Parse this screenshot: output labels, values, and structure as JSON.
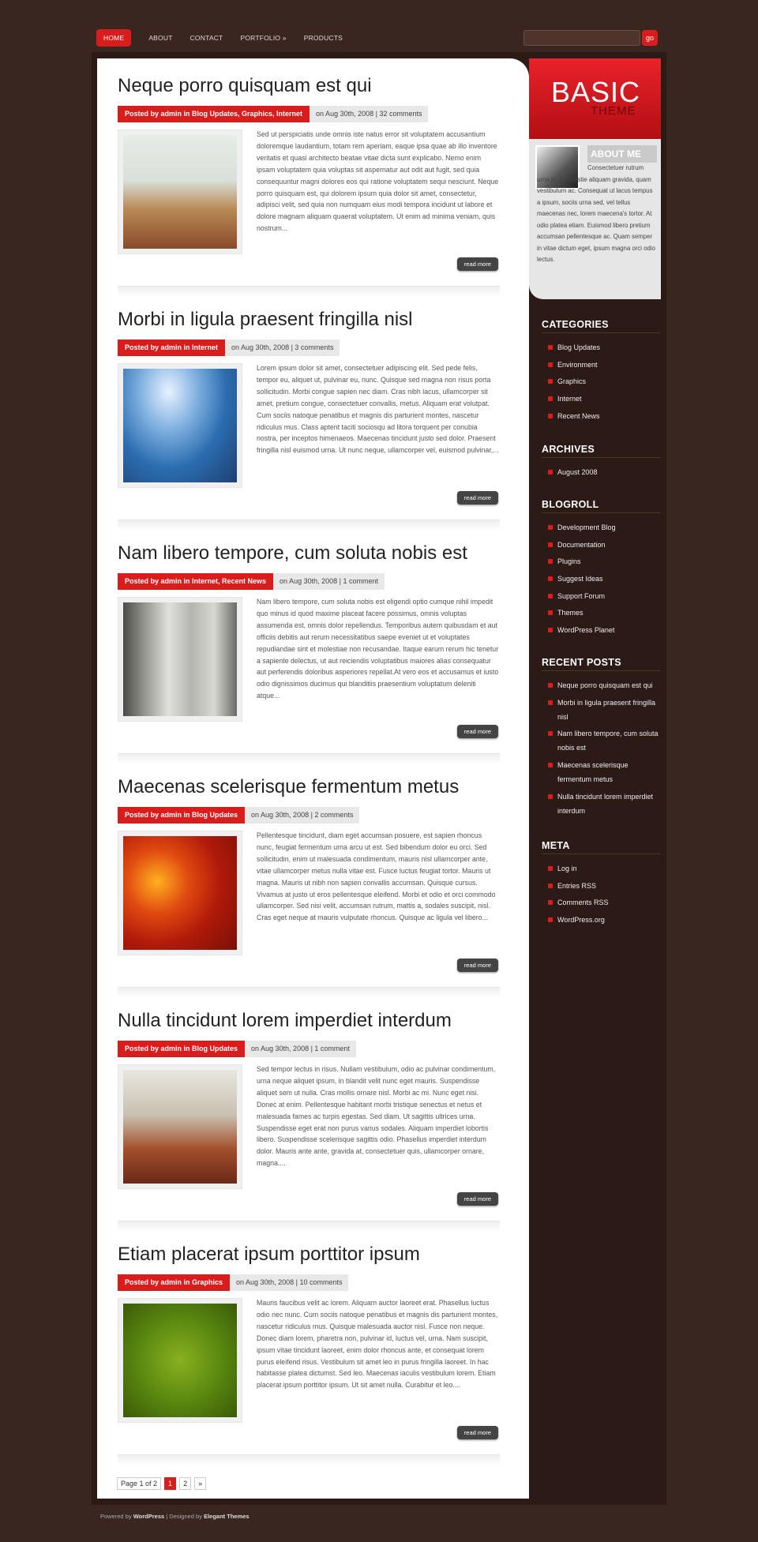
{
  "nav": {
    "items": [
      {
        "label": "HOME"
      },
      {
        "label": "ABOUT"
      },
      {
        "label": "CONTACT"
      },
      {
        "label": "PORTFOLIO »"
      },
      {
        "label": "PRODUCTS"
      }
    ],
    "search_button": "go"
  },
  "posts": [
    {
      "title": "Neque porro quisquam est qui",
      "by": "Posted by admin in Blog Updates, Graphics, Internet",
      "on": "on Aug 30th, 2008 | 32 comments",
      "excerpt": "Sed ut perspiciatis unde omnis iste natus error sit voluptatem accusantium doloremque laudantium, totam rem aperiam, eaque ipsa quae ab illo inventore veritatis et quasi architecto beatae vitae dicta sunt explicabo. Nemo enim ipsam voluptatem quia voluptas sit aspernatur aut odit aut fugit, sed quia consequuntur magni dolores eos qui ratione voluptatem sequi nesciunt. Neque porro quisquam est, qui dolorem ipsum quia dolor sit amet, consectetur, adipisci velit, sed quia non numquam eius modi tempora incidunt ut labore et dolore magnam aliquam quaerat voluptatem. Ut enim ad minima veniam, quis nostrum...",
      "readmore": "read more"
    },
    {
      "title": "Morbi in ligula praesent fringilla nisl",
      "by": "Posted by admin in Internet",
      "on": "on Aug 30th, 2008 | 3 comments",
      "excerpt": "Lorem ipsum dolor sit amet, consectetuer adipiscing elit. Sed pede felis, tempor eu, aliquet ut, pulvinar eu, nunc. Quisque sed magna non risus porta sollicitudin. Morbi congue sapien nec diam. Cras nibh lacus, ullamcorper sit amet, pretium congue, consectetuer convallis, metus. Aliquam erat volutpat. Cum sociis natoque penatibus et magnis dis parturient montes, nascetur ridiculus mus. Class aptent taciti sociosqu ad litora torquent per conubia nostra, per inceptos himenaeos. Maecenas tincidunt justo sed dolor. Praesent fringilla nisl euismod urna. Ut nunc neque, ullamcorper vel, euismod pulvinar,...",
      "readmore": "read more"
    },
    {
      "title": "Nam libero tempore, cum soluta nobis est",
      "by": "Posted by admin in Internet, Recent News",
      "on": "on Aug 30th, 2008 | 1 comment",
      "excerpt": "Nam libero tempore, cum soluta nobis est eligendi optio cumque nihil impedit quo minus id quod maxime placeat facere possimus, omnis voluptas assumenda est, omnis dolor repellendus. Temporibus autem quibusdam et aut officiis debitis aut rerum necessitatibus saepe eveniet ut et voluptates repudiandae sint et molestiae non recusandae. Itaque earum rerum hic tenetur a sapiente delectus, ut aut reiciendis voluptatibus maiores alias consequatur aut perferendis doloribus asperiores repellat.At vero eos et accusamus et iusto odio dignissimos ducimus qui blanditiis praesentium voluptatum deleniti atque...",
      "readmore": "read more"
    },
    {
      "title": "Maecenas scelerisque fermentum metus",
      "by": "Posted by admin in Blog Updates",
      "on": "on Aug 30th, 2008 | 2 comments",
      "excerpt": "Pellentesque tincidunt, diam eget accumsan posuere, est sapien rhoncus nunc, feugiat fermentum urna arcu ut est. Sed bibendum dolor eu orci. Sed sollicitudin, enim ut malesuada condimentum, mauris nisl ullamcorper ante, vitae ullamcorper metus nulla vitae est. Fusce luctus feugiat tortor. Mauris ut magna. Mauris ut nibh non sapien convallis accumsan. Quisque cursus. Vivamus at justo ut eros pellentesque eleifend. Morbi et odio et orci commodo ullamcorper. Sed nisi velit, accumsan rutrum, mattis a, sodales suscipit, nisl. Cras eget neque at mauris vulputate rhoncus. Quisque ac ligula vel libero...",
      "readmore": "read more"
    },
    {
      "title": "Nulla tincidunt lorem imperdiet interdum",
      "by": "Posted by admin in Blog Updates",
      "on": "on Aug 30th, 2008 | 1 comment",
      "excerpt": "Sed tempor lectus in risus. Nullam vestibulum, odio ac pulvinar condimentum, urna neque aliquet ipsum, in blandit velit nunc eget mauris. Suspendisse aliquet sem ut nulla. Cras mollis ornare nisl. Morbi ac mi. Nunc eget nisi. Donec at enim. Pellentesque habitant morbi tristique senectus et netus et malesuada fames ac turpis egestas. Sed diam. Ut sagittis ultrices urna. Suspendisse eget erat non purus varius sodales. Aliquam imperdiet lobortis libero. Suspendisse scelerisque sagittis odio. Phasellus imperdiet interdum dolor. Mauris ante ante, gravida at, consectetuer quis, ullamcorper ornare, magna....",
      "readmore": "read more"
    },
    {
      "title": "Etiam placerat ipsum porttitor ipsum",
      "by": "Posted by admin in Graphics",
      "on": "on Aug 30th, 2008 | 10 comments",
      "excerpt": "Mauris faucibus velit ac lorem. Aliquam auctor laoreet erat. Phasellus luctus odio nec nunc. Cum sociis natoque penatibus et magnis dis parturient montes, nascetur ridiculus mus. Quisque malesuada auctor nisl. Fusce non neque. Donec diam lorem, pharetra non, pulvinar id, luctus vel, urna. Nam suscipit, ipsum vitae tincidunt laoreet, enim dolor rhoncus ante, et consequat lorem purus eleifend risus. Vestibulum sit amet leo in purus fringilla laoreet. In hac habitasse platea dictumst. Sed leo. Maecenas iaculis vestibulum lorem. Etiam placerat ipsum porttitor ipsum. Ut sit amet nulla. Curabitur et leo....",
      "readmore": "read more"
    }
  ],
  "pagination": {
    "label": "Page 1 of 2",
    "current": "1",
    "next_page": "2",
    "next": "»"
  },
  "sidebar": {
    "basic_title": "BASIC",
    "basic_sub": "THEME",
    "about_heading": "ABOUT ME",
    "about_text": "Consectetuer rutrum urna in, a molestie aliquam gravida, quam vestibulum ac. Consequat ut lacus tempus a ipsum, sociis urna sed, vel tellus maecenas nec, lorem maecena's tortor. At odio platea etiam. Euismod libero pretium accumsan pellentesque ac. Quam semper in vitae dictum eget, ipsum magna orci odio lectus.",
    "categories": {
      "title": "CATEGORIES",
      "items": [
        "Blog Updates",
        "Environment",
        "Graphics",
        "Internet",
        "Recent News"
      ]
    },
    "archives": {
      "title": "ARCHIVES",
      "items": [
        "August 2008"
      ]
    },
    "blogroll": {
      "title": "BLOGROLL",
      "items": [
        "Development Blog",
        "Documentation",
        "Plugins",
        "Suggest Ideas",
        "Support Forum",
        "Themes",
        "WordPress Planet"
      ]
    },
    "recent": {
      "title": "RECENT POSTS",
      "items": [
        "Neque porro quisquam est qui",
        "Morbi in ligula praesent fringilla nisl",
        "Nam libero tempore, cum soluta nobis est",
        "Maecenas scelerisque fermentum metus",
        "Nulla tincidunt lorem imperdiet interdum"
      ]
    },
    "meta": {
      "title": "META",
      "items": [
        "Log in",
        "Entries RSS",
        "Comments RSS",
        "WordPress.org"
      ]
    }
  },
  "footer": {
    "powered": "Powered by ",
    "wp": "WordPress",
    "sep": " | Designed by ",
    "et": "Elegant Themes"
  },
  "colors": {
    "accent": "#d91c1c",
    "background": "#3a2620"
  }
}
